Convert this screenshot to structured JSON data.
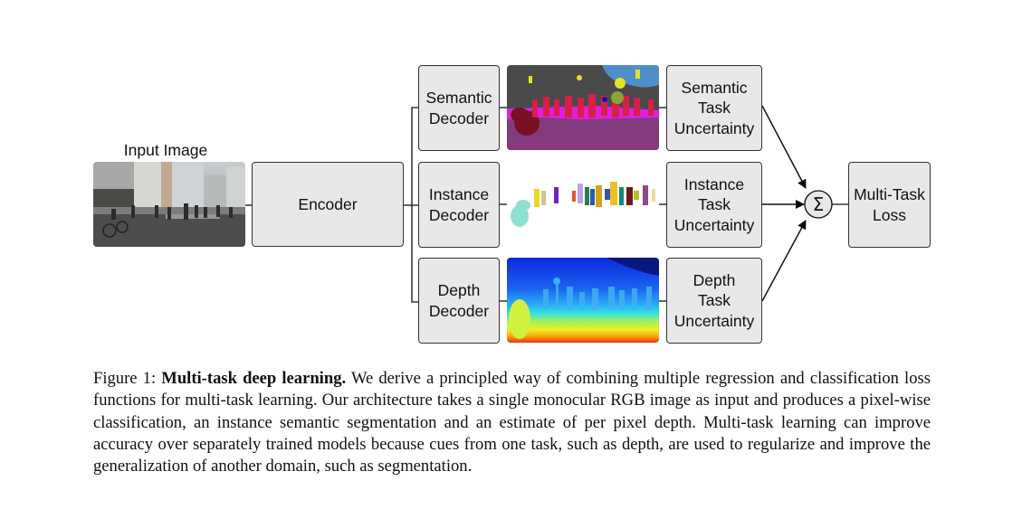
{
  "diagram": {
    "input_label": "Input Image",
    "encoder": "Encoder",
    "decoders": [
      {
        "line1": "Semantic",
        "line2": "Decoder"
      },
      {
        "line1": "Instance",
        "line2": "Decoder"
      },
      {
        "line1": "Depth",
        "line2": "Decoder"
      }
    ],
    "uncertainties": [
      {
        "line1": "Semantic",
        "line2": "Task",
        "line3": "Uncertainty"
      },
      {
        "line1": "Instance",
        "line2": "Task",
        "line3": "Uncertainty"
      },
      {
        "line1": "Depth",
        "line2": "Task",
        "line3": "Uncertainty"
      }
    ],
    "sum_symbol": "Σ",
    "loss": {
      "line1": "Multi-Task",
      "line2": "Loss"
    },
    "thumbnails": [
      "input-street-scene",
      "semantic-segmentation-output",
      "instance-segmentation-output",
      "depth-map-output"
    ]
  },
  "caption": {
    "figure_label": "Figure 1:",
    "bold_title": "Multi-task deep learning.",
    "text": "We derive a principled way of combining multiple regression and classification loss functions for multi-task learning. Our architecture takes a single monocular RGB image as input and produces a pixel-wise classification, an instance semantic segmentation and an estimate of per pixel depth. Multi-task learning can improve accuracy over separately trained models because cues from one task, such as depth, are used to regularize and improve the generalization of another domain, such as segmentation."
  }
}
